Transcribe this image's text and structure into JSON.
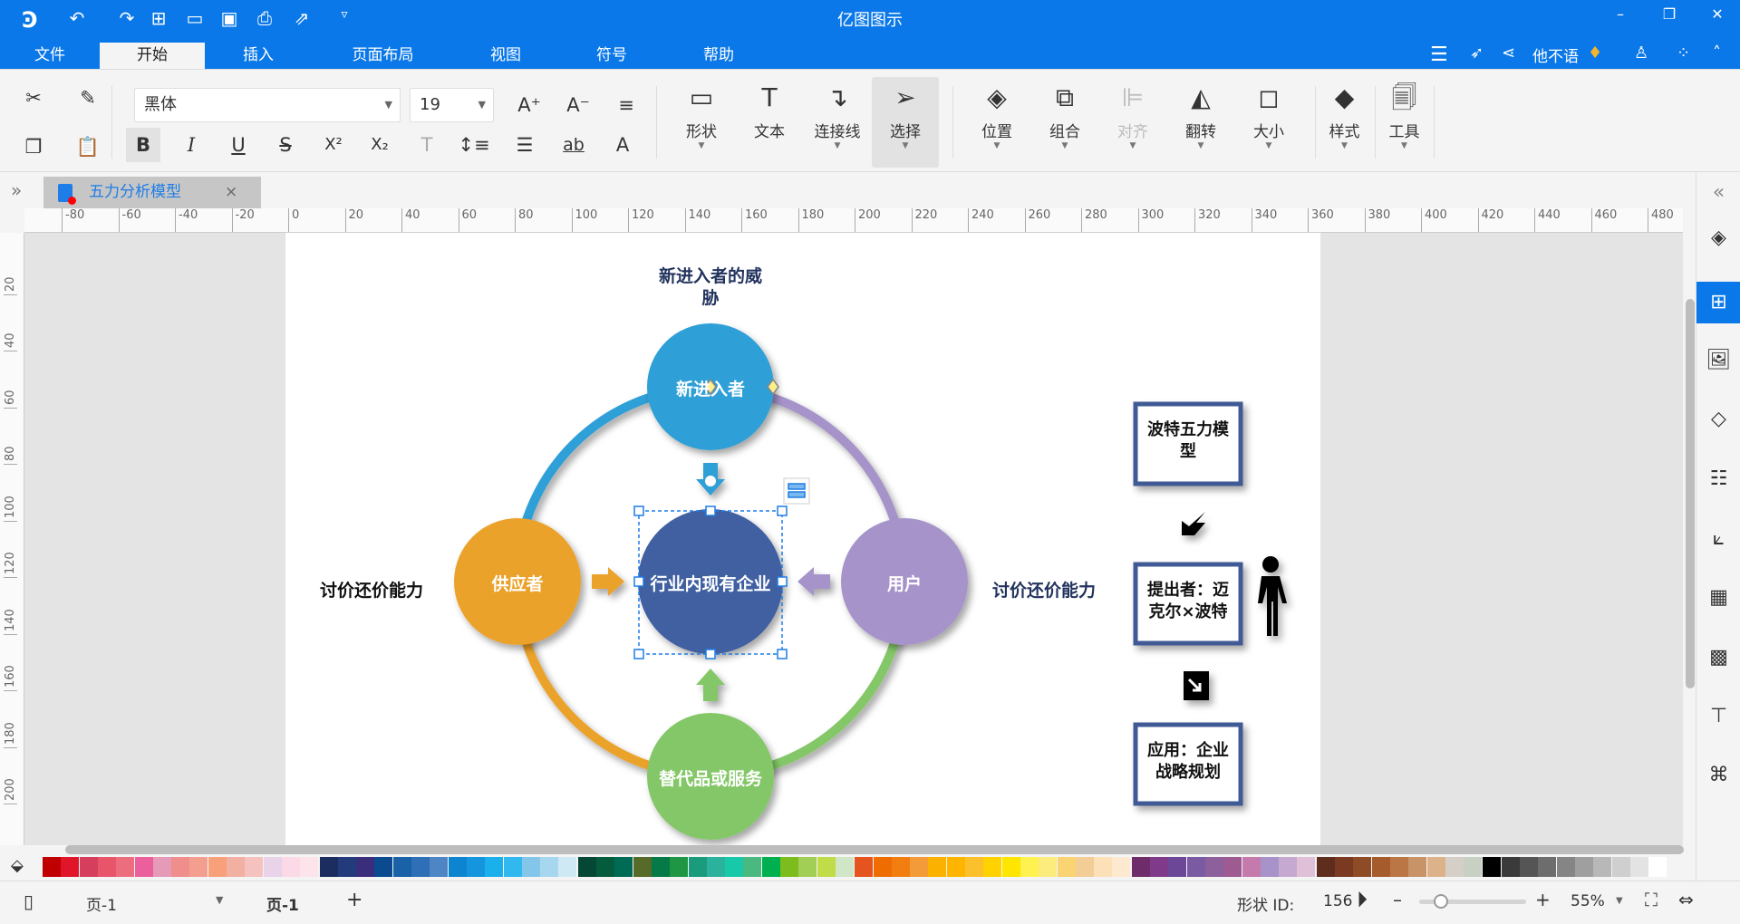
{
  "app": {
    "title": "亿图图示",
    "user": "他不语"
  },
  "menu": {
    "tabs": [
      "文件",
      "开始",
      "插入",
      "页面布局",
      "视图",
      "符号",
      "帮助"
    ],
    "active": 1
  },
  "ribbon": {
    "font": "黑体",
    "size": "19",
    "big": [
      {
        "label": "形状",
        "icon": "rectangle-icon"
      },
      {
        "label": "文本",
        "icon": "text-icon"
      },
      {
        "label": "连接线",
        "icon": "connector-icon"
      },
      {
        "label": "选择",
        "icon": "pointer-icon"
      },
      {
        "label": "位置",
        "icon": "position-icon"
      },
      {
        "label": "组合",
        "icon": "group-icon"
      },
      {
        "label": "对齐",
        "icon": "align-icon"
      },
      {
        "label": "翻转",
        "icon": "flip-icon"
      },
      {
        "label": "大小",
        "icon": "size-icon"
      },
      {
        "label": "样式",
        "icon": "style-icon"
      },
      {
        "label": "工具",
        "icon": "tools-icon"
      }
    ],
    "text_super": "X²",
    "text_sub": "X₂",
    "ab": "ab"
  },
  "document": {
    "tab": "五力分析模型"
  },
  "ruler": {
    "h": [
      "-80",
      "-60",
      "-40",
      "-20",
      "0",
      "20",
      "40",
      "60",
      "80",
      "100",
      "120",
      "140",
      "160",
      "180",
      "200",
      "220",
      "240",
      "260",
      "280",
      "300",
      "320",
      "340",
      "360",
      "380",
      "400",
      "420",
      "440",
      "460",
      "480"
    ],
    "v": [
      "20",
      "40",
      "60",
      "80",
      "100",
      "120",
      "140",
      "160",
      "180",
      "200"
    ]
  },
  "diagram": {
    "title": [
      "新进入者的威",
      "胁"
    ],
    "top": "新进入者",
    "center": "行业内现有企业",
    "left": "供应者",
    "right": "用户",
    "bottom": "替代品或服务",
    "left_label": "讨价还价能力",
    "right_label": "讨价还价能力",
    "box1": [
      "波特五力模",
      "型"
    ],
    "box2": [
      "提出者：迈",
      "克尔×波特"
    ],
    "box3": [
      "应用：企业",
      "战略规划"
    ],
    "colors": {
      "top": "#2d9fd7",
      "center": "#3f60a2",
      "left": "#eba22c",
      "right": "#a693ca",
      "bottom": "#84c767"
    }
  },
  "palette": [
    "#c00000",
    "#e0152a",
    "#d63e5e",
    "#e8546a",
    "#ec6d7e",
    "#ea5f9c",
    "#e59ab8",
    "#f08e8c",
    "#f49e8f",
    "#f7a07a",
    "#f2b0a2",
    "#f5c2c0",
    "#e8d3e8",
    "#fbd9e6",
    "#fde3ea",
    "#1a2d5e",
    "#233b7a",
    "#3a2e7c",
    "#0b4a8e",
    "#1962a8",
    "#2e6fb8",
    "#4d85c5",
    "#0d84cf",
    "#1595dd",
    "#1ab0ec",
    "#30b8ef",
    "#84c6ea",
    "#a7d7ef",
    "#cfe9f4",
    "#034734",
    "#055c3d",
    "#006b55",
    "#566a2a",
    "#057a46",
    "#1e9643",
    "#1a9c7c",
    "#2ab29d",
    "#17c9a8",
    "#49b97f",
    "#00b050",
    "#7cbd1d",
    "#a1cf55",
    "#c0dc48",
    "#d0e6c6",
    "#e5531f",
    "#ee6c00",
    "#f27e12",
    "#f39a39",
    "#fbb100",
    "#ffb400",
    "#fcc02c",
    "#ffd200",
    "#ffe600",
    "#fff150",
    "#fbec7d",
    "#fad473",
    "#f2cd96",
    "#fbe0b8",
    "#fce9d0",
    "#6e2c6a",
    "#7f3b8a",
    "#6c4798",
    "#7a5aa3",
    "#8d5f9b",
    "#9e5b92",
    "#c47aad",
    "#a792c9",
    "#c6a9d0",
    "#e0c0d8",
    "#5e2d1d",
    "#7a3a22",
    "#8f4a26",
    "#a55b2c",
    "#bb7646",
    "#c89366",
    "#dcb28b",
    "#d6cfc7",
    "#c8d0c3",
    "#000000",
    "#3a3a3a",
    "#555555",
    "#6d6d6d",
    "#858585",
    "#9f9f9f",
    "#b8b8b8",
    "#cfcfcf",
    "#e3e3e3",
    "#ffffff"
  ],
  "status": {
    "page_select": "页-1",
    "page_tab": "页-1",
    "shape_id_label": "形状 ID:",
    "shape_id": "156",
    "zoom": "55%",
    "zoom_fraction": 0.2
  }
}
